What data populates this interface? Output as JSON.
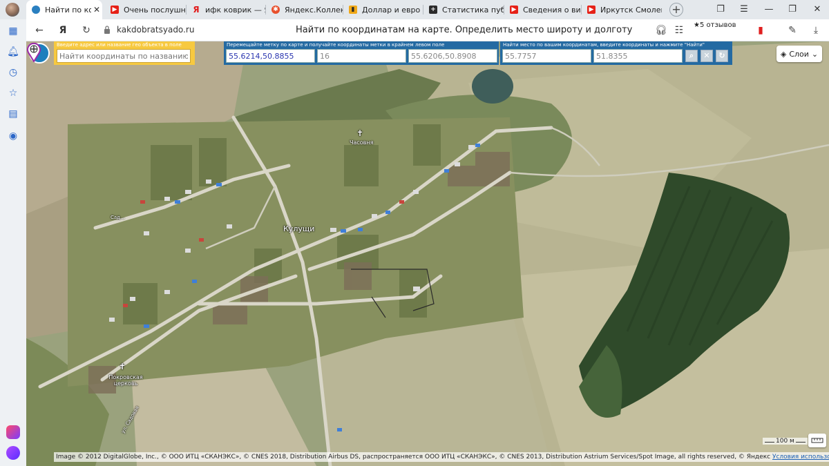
{
  "browser": {
    "tabs": [
      {
        "label": "Найти по коор",
        "icon": "globe-icon",
        "color": "#2a7fc0",
        "active": true
      },
      {
        "label": "Очень послушны",
        "icon": "youtube-icon",
        "color": "#e62117"
      },
      {
        "label": "ифк коврик — Ян",
        "icon": "yandex-icon",
        "color": "#e21b1b"
      },
      {
        "label": "Яндекс.Коллекци",
        "icon": "collections-icon",
        "color": "#e8502d"
      },
      {
        "label": "Доллар и евро р",
        "icon": "finance-icon",
        "color": "#2b2b2b"
      },
      {
        "label": "Статистика публ",
        "icon": "plus-icon",
        "color": "#2b2b2b"
      },
      {
        "label": "Сведения о виде",
        "icon": "youtube-icon",
        "color": "#e62117"
      },
      {
        "label": "Иркутск Смолен",
        "icon": "youtube-icon",
        "color": "#e62117"
      }
    ],
    "domain": "kakdobratsyado.ru",
    "page_title": "Найти по координатам на карте. Определить место широту и долготу",
    "reviews": "★5 отзывов"
  },
  "map": {
    "search": {
      "caption": "Введите адрес или название гео объекта в поле",
      "placeholder": "Найти координаты по названию"
    },
    "marker_panel": {
      "caption": "Перемещайте метку по карте и получайте координаты метки в крайнем левом поле",
      "marker_coords": "55.6214,50.8855",
      "zoom": "16",
      "center_coords": "55.6206,50.8908"
    },
    "find_panel": {
      "caption": "Найти место по вашим координатам, введите координаты и нажмите \"Найти\"",
      "lat": "55.7757",
      "lon": "51.8355"
    },
    "layers_label": "Слои",
    "places": {
      "village": "Кулущи",
      "chapel": "Часовня",
      "church": "Покровская церковь",
      "street1": "Сад...",
      "street2": "ул. Садовая"
    },
    "scale_label": "100 м",
    "copyright": "Image © 2012 DigitalGlobe, Inc., © ООО ИТЦ «СКАНЭКС», © CNES 2018, Distribution Airbus DS, распространяется ООО ИТЦ «СКАНЭКС», © CNES 2013, Distribution Astrium Services/Spot Image, all rights reserved, © Яндекс",
    "terms_link": "Условия использования"
  }
}
